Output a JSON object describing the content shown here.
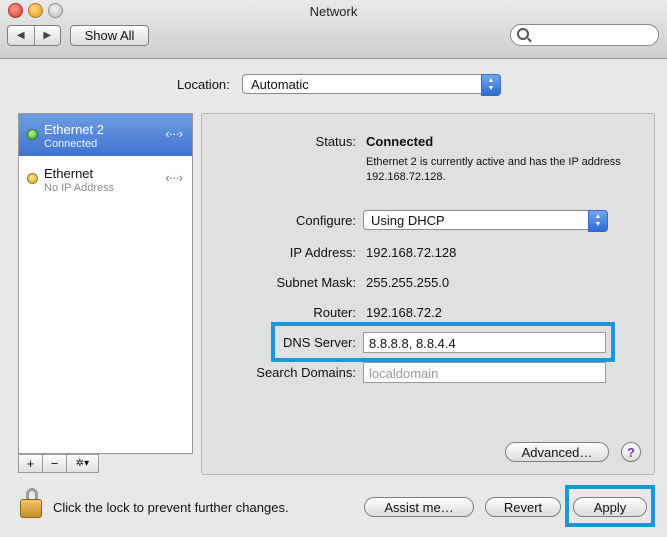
{
  "window": {
    "title": "Network"
  },
  "toolbar": {
    "back_label": "◀",
    "forward_label": "▶",
    "show_all_label": "Show All",
    "search_placeholder": ""
  },
  "location": {
    "label": "Location:",
    "value": "Automatic"
  },
  "services": [
    {
      "name": "Ethernet 2",
      "status": "Connected",
      "state_color": "#3aa91b",
      "icon": "ethernet-icon",
      "selected": true
    },
    {
      "name": "Ethernet",
      "status": "No IP Address",
      "state_color": "#e0a214",
      "icon": "ethernet-icon",
      "selected": false
    }
  ],
  "sidebar_tools": {
    "add_label": "+",
    "remove_label": "−",
    "action_label": "✲▾"
  },
  "detail": {
    "status_label": "Status:",
    "status_value": "Connected",
    "status_description": "Ethernet 2 is currently active and has the IP address 192.168.72.128.",
    "configure_label": "Configure:",
    "configure_value": "Using DHCP",
    "ip_label": "IP Address:",
    "ip_value": "192.168.72.128",
    "subnet_label": "Subnet Mask:",
    "subnet_value": "255.255.255.0",
    "router_label": "Router:",
    "router_value": "192.168.72.2",
    "dns_label": "DNS Server:",
    "dns_value": "8.8.8.8, 8.8.4.4",
    "search_domains_label": "Search Domains:",
    "search_domains_placeholder": "localdomain",
    "advanced_label": "Advanced…",
    "help_label": "?"
  },
  "footer": {
    "lock_text": "Click the lock to prevent further changes.",
    "assist_label": "Assist me…",
    "revert_label": "Revert",
    "apply_label": "Apply"
  },
  "highlight_color": "#1b96d6"
}
